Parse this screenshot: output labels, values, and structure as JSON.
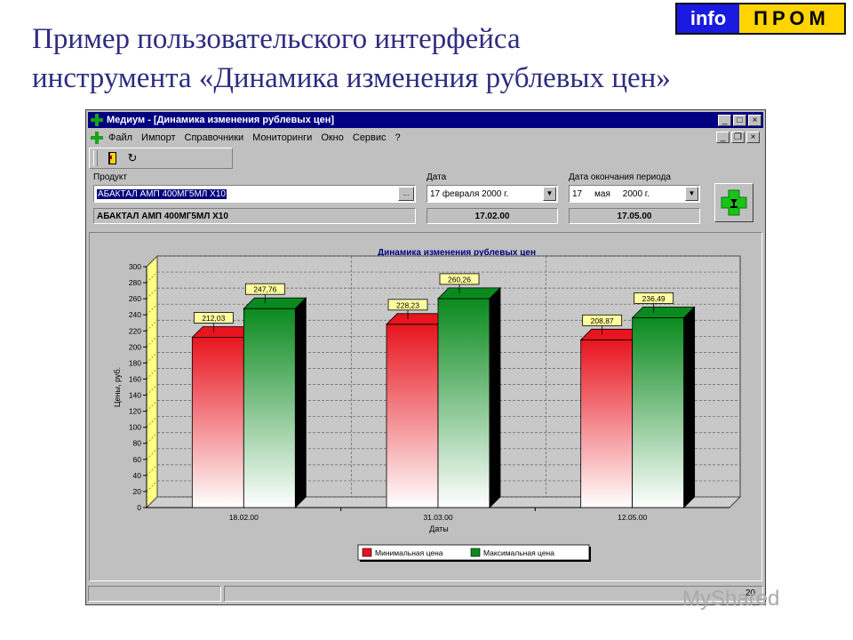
{
  "slide": {
    "title_line1": "Пример пользовательского интерфейса",
    "title_line2": "инструмента «Динамика изменения рублевых цен»",
    "logo_left": "info",
    "logo_right": "ПРОМ"
  },
  "window": {
    "title": "Медиум - [Динамика изменения рублевых цен]",
    "buttons": {
      "minimize": "_",
      "maximize": "□",
      "close": "×",
      "restore": "❐"
    }
  },
  "menu": {
    "items": [
      "Файл",
      "Импорт",
      "Справочники",
      "Мониторинги",
      "Окно",
      "Сервис",
      "?"
    ]
  },
  "form": {
    "product_label": "Продукт",
    "product_value": "АБАКТАЛ АМП 400МГ5МЛ Х10",
    "product_button": "...",
    "product_display": "АБАКТАЛ АМП 400МГ5МЛ Х10",
    "date_label": "Дата",
    "date_value": "17 февраля 2000 г.",
    "date_display": "17.02.00",
    "end_label": "Дата окончания периода",
    "end_value": "17     мая     2000 г.",
    "end_display": "17.05.00"
  },
  "status": {
    "page_number": "20"
  },
  "watermark": "MyShared",
  "colors": {
    "min": "#e8141e",
    "max": "#0a8a1e",
    "window_title": "#000080",
    "slide_title": "#2d2d80"
  },
  "chart_data": {
    "type": "bar",
    "title": "Динамика изменения рублевых цен",
    "xlabel": "Даты",
    "ylabel": "Цены, руб.",
    "ylim": [
      0,
      300
    ],
    "yticks": [
      0,
      20,
      40,
      60,
      80,
      100,
      120,
      140,
      160,
      180,
      200,
      220,
      240,
      260,
      280,
      300
    ],
    "categories": [
      "18.02.00",
      "31.03.00",
      "12.05.00"
    ],
    "series": [
      {
        "name": "Минимальная цена",
        "values": [
          212.03,
          228.23,
          208.87
        ],
        "labels": [
          "212,03",
          "228,23",
          "208,87"
        ],
        "color": "#e8141e"
      },
      {
        "name": "Максимальная цена",
        "values": [
          247.76,
          260.26,
          236.49
        ],
        "labels": [
          "247,76",
          "260,26",
          "236,49"
        ],
        "color": "#0a8a1e"
      }
    ],
    "grid": true,
    "legend": "bottom"
  }
}
